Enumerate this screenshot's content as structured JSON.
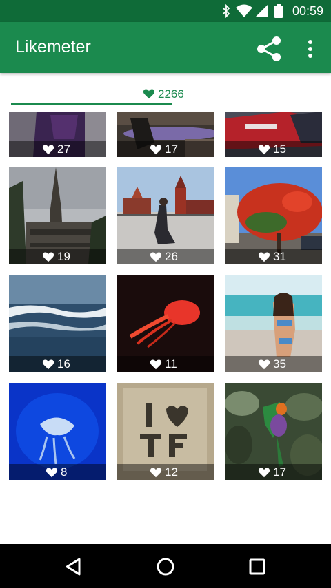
{
  "status_bar": {
    "time": "00:59",
    "icons": [
      "bluetooth-icon",
      "wifi-icon",
      "signal-icon",
      "battery-icon"
    ]
  },
  "app_bar": {
    "title": "Likemeter",
    "actions": [
      "share-icon",
      "more-vert-icon"
    ]
  },
  "summary": {
    "total_likes": "2266",
    "accent_color": "#1b8a4e"
  },
  "photos": [
    {
      "likes": "27",
      "theme": "purple-shirt-photo"
    },
    {
      "likes": "17",
      "theme": "person-on-stage-photo"
    },
    {
      "likes": "15",
      "theme": "red-sports-car-photo"
    },
    {
      "likes": "19",
      "theme": "gothic-town-hall-photo"
    },
    {
      "likes": "26",
      "theme": "red-square-jump-photo"
    },
    {
      "likes": "31",
      "theme": "red-flowering-tree-photo"
    },
    {
      "likes": "16",
      "theme": "ocean-waves-photo"
    },
    {
      "likes": "11",
      "theme": "red-jellyfish-photo"
    },
    {
      "likes": "35",
      "theme": "beach-bikini-photo"
    },
    {
      "likes": "8",
      "theme": "blue-jellyfish-photo"
    },
    {
      "likes": "12",
      "theme": "i-love-tf-sign-photo"
    },
    {
      "likes": "17",
      "theme": "parrot-in-leaves-photo"
    }
  ],
  "nav_bar": {
    "buttons": [
      "back-icon",
      "home-icon",
      "recents-icon"
    ]
  }
}
